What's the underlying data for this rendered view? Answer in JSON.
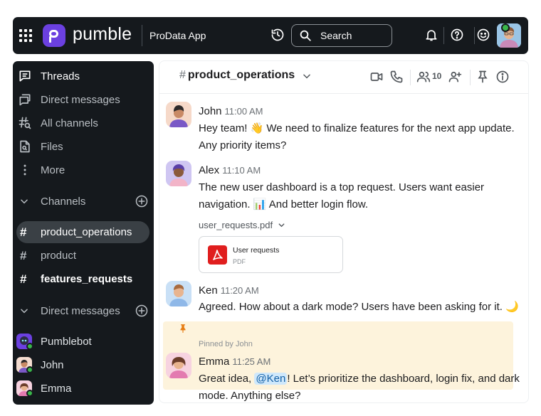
{
  "app": {
    "brand": "pumble",
    "workspace": "ProData App",
    "search_placeholder": "Search",
    "colors": {
      "brand_purple": "#6b40e0",
      "dark_bg": "#15191d",
      "online": "#39b64a",
      "pinned_bg": "#fdf3dc"
    }
  },
  "sidebar": {
    "nav": [
      {
        "label": "Threads",
        "icon": "threads-icon"
      },
      {
        "label": "Direct messages",
        "icon": "direct-messages-icon"
      },
      {
        "label": "All channels",
        "icon": "all-channels-icon"
      },
      {
        "label": "Files",
        "icon": "files-icon"
      },
      {
        "label": "More",
        "icon": "more-icon"
      }
    ],
    "channels_header": "Channels",
    "channels": [
      {
        "name": "product_operations",
        "state": "selected"
      },
      {
        "name": "product",
        "state": "normal"
      },
      {
        "name": "features_requests",
        "state": "unread"
      }
    ],
    "dms_header": "Direct messages",
    "dms": [
      {
        "name": "Pumblebot"
      },
      {
        "name": "John"
      },
      {
        "name": "Emma"
      }
    ]
  },
  "channel": {
    "hash": "#",
    "name": "product_operations",
    "member_count": "10"
  },
  "messages": [
    {
      "author": "John",
      "time": "11:00 AM",
      "text": "Hey team! 👋 We need to finalize features for the next app update. Any priority items?"
    },
    {
      "author": "Alex",
      "time": "11:10 AM",
      "text": "The new user dashboard is a top request. Users want easier navigation. 📊 And better login flow."
    },
    {
      "author": "Ken",
      "time": "11:20 AM",
      "text": "Agreed. How about a dark mode? Users have been asking for it. 🌙"
    },
    {
      "author": "Emma",
      "time": "11:25 AM",
      "text_before": "Great idea, ",
      "mention": "@Ken",
      "text_after": "! Let’s prioritize the dashboard, login fix, and dark mode. Anything else?"
    }
  ],
  "attachment": {
    "title": "user_requests.pdf",
    "name": "User requests",
    "type": "PDF"
  },
  "pinned_label": "Pinned by John"
}
